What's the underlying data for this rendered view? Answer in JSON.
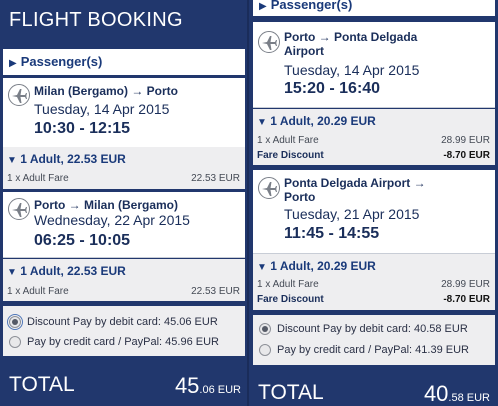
{
  "panel_a": {
    "title": "FLIGHT BOOKING",
    "passengers_label": "Passenger(s)",
    "flights": [
      {
        "route": "Milan (Bergamo) → Porto",
        "date": "Tuesday, 14 Apr 2015",
        "time": "10:30 - 12:15",
        "fare_header": "1 Adult, 22.53 EUR",
        "fare_line_label": "1 x Adult Fare",
        "fare_line_amount": "22.53 EUR"
      },
      {
        "route": "Porto → Milan (Bergamo)",
        "date": "Wednesday, 22 Apr 2015",
        "time": "06:25 - 10:05",
        "fare_header": "1 Adult, 22.53 EUR",
        "fare_line_label": "1 x Adult Fare",
        "fare_line_amount": "22.53 EUR"
      }
    ],
    "payment": {
      "debit_label": "Discount Pay by debit card: 45.06 EUR",
      "credit_label": "Pay by credit card / PayPal: 45.96 EUR",
      "selected": "debit"
    },
    "total_label": "TOTAL",
    "total_whole": "45",
    "total_cents": ".06 EUR"
  },
  "panel_b": {
    "passengers_label": "Passenger(s)",
    "flights": [
      {
        "route_line1": "Porto → Ponta Delgada",
        "route_line2": "Airport",
        "date": "Tuesday, 14 Apr 2015",
        "time": "15:20 - 16:40",
        "fare_header": "1 Adult, 20.29 EUR",
        "fare_line_label": "1 x Adult Fare",
        "fare_line_amount": "28.99 EUR",
        "discount_label": "Fare Discount",
        "discount_amount": "-8.70 EUR"
      },
      {
        "route_line1": "Ponta Delgada Airport →",
        "route_line2": "Porto",
        "date": "Tuesday, 21 Apr 2015",
        "time": "11:45 - 14:55",
        "fare_header": "1 Adult, 20.29 EUR",
        "fare_line_label": "1 x Adult Fare",
        "fare_line_amount": "28.99 EUR",
        "discount_label": "Fare Discount",
        "discount_amount": "-8.70 EUR"
      }
    ],
    "payment": {
      "debit_label": "Discount Pay by debit card: 40.58 EUR",
      "credit_label": "Pay by credit card / PayPal: 41.39 EUR",
      "selected": "debit"
    },
    "total_label": "TOTAL",
    "total_whole": "40",
    "total_cents": ".58 EUR"
  },
  "colors": {
    "panel_bg": "#21376d",
    "card_bg": "#ffffff",
    "fare_bg": "#eeeef0",
    "accent_text": "#1a3a7a"
  },
  "icons": {
    "flight": "airplane-icon",
    "expand": "triangle-right-icon",
    "collapse": "triangle-down-icon"
  }
}
